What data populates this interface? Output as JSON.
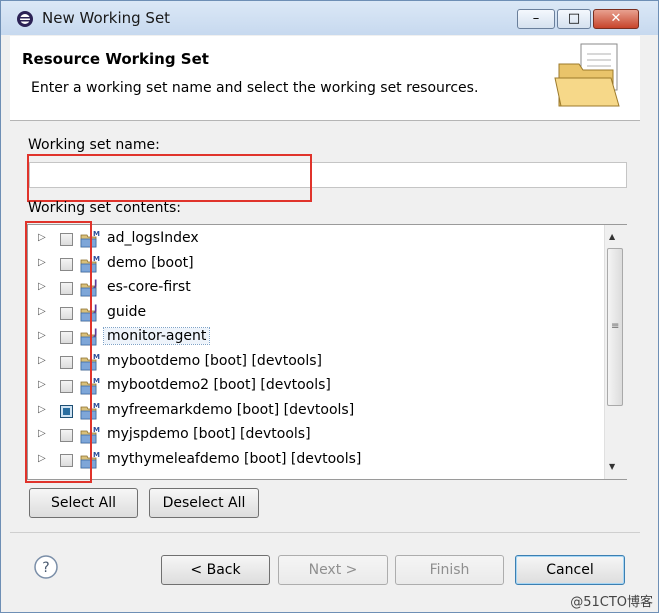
{
  "window": {
    "title": "New Working Set",
    "controls": {
      "minimize": "–",
      "maximize": "□",
      "close": "✕"
    }
  },
  "header": {
    "title": "Resource Working Set",
    "description": "Enter a working set name and select the working set resources."
  },
  "name_field": {
    "label": "Working set name:",
    "value": ""
  },
  "contents": {
    "label": "Working set contents:",
    "items": [
      {
        "label": "ad_logsIndex",
        "checked": false,
        "icon": "maven-project-icon"
      },
      {
        "label": "demo [boot]",
        "checked": false,
        "icon": "maven-project-icon"
      },
      {
        "label": "es-core-first",
        "checked": false,
        "icon": "java-project-icon"
      },
      {
        "label": "guide",
        "checked": false,
        "icon": "java-project-icon"
      },
      {
        "label": "monitor-agent",
        "checked": false,
        "icon": "java-project-icon",
        "focused": true
      },
      {
        "label": "mybootdemo [boot] [devtools]",
        "checked": false,
        "icon": "maven-project-icon"
      },
      {
        "label": "mybootdemo2 [boot] [devtools]",
        "checked": false,
        "icon": "maven-project-icon"
      },
      {
        "label": "myfreemarkdemo [boot] [devtools]",
        "checked": true,
        "icon": "maven-project-icon"
      },
      {
        "label": "myjspdemo [boot] [devtools]",
        "checked": false,
        "icon": "maven-project-icon"
      },
      {
        "label": "mythymeleafdemo [boot] [devtools]",
        "checked": false,
        "icon": "maven-project-icon"
      }
    ]
  },
  "select_buttons": {
    "select_all": "Select All",
    "deselect_all": "Deselect All"
  },
  "footer": {
    "back": "< Back",
    "next": "Next >",
    "finish": "Finish",
    "cancel": "Cancel"
  },
  "watermark": "@51CTO博客",
  "colors": {
    "highlight_box": "#e0332b",
    "checked_fill": "#2a6ea0"
  }
}
